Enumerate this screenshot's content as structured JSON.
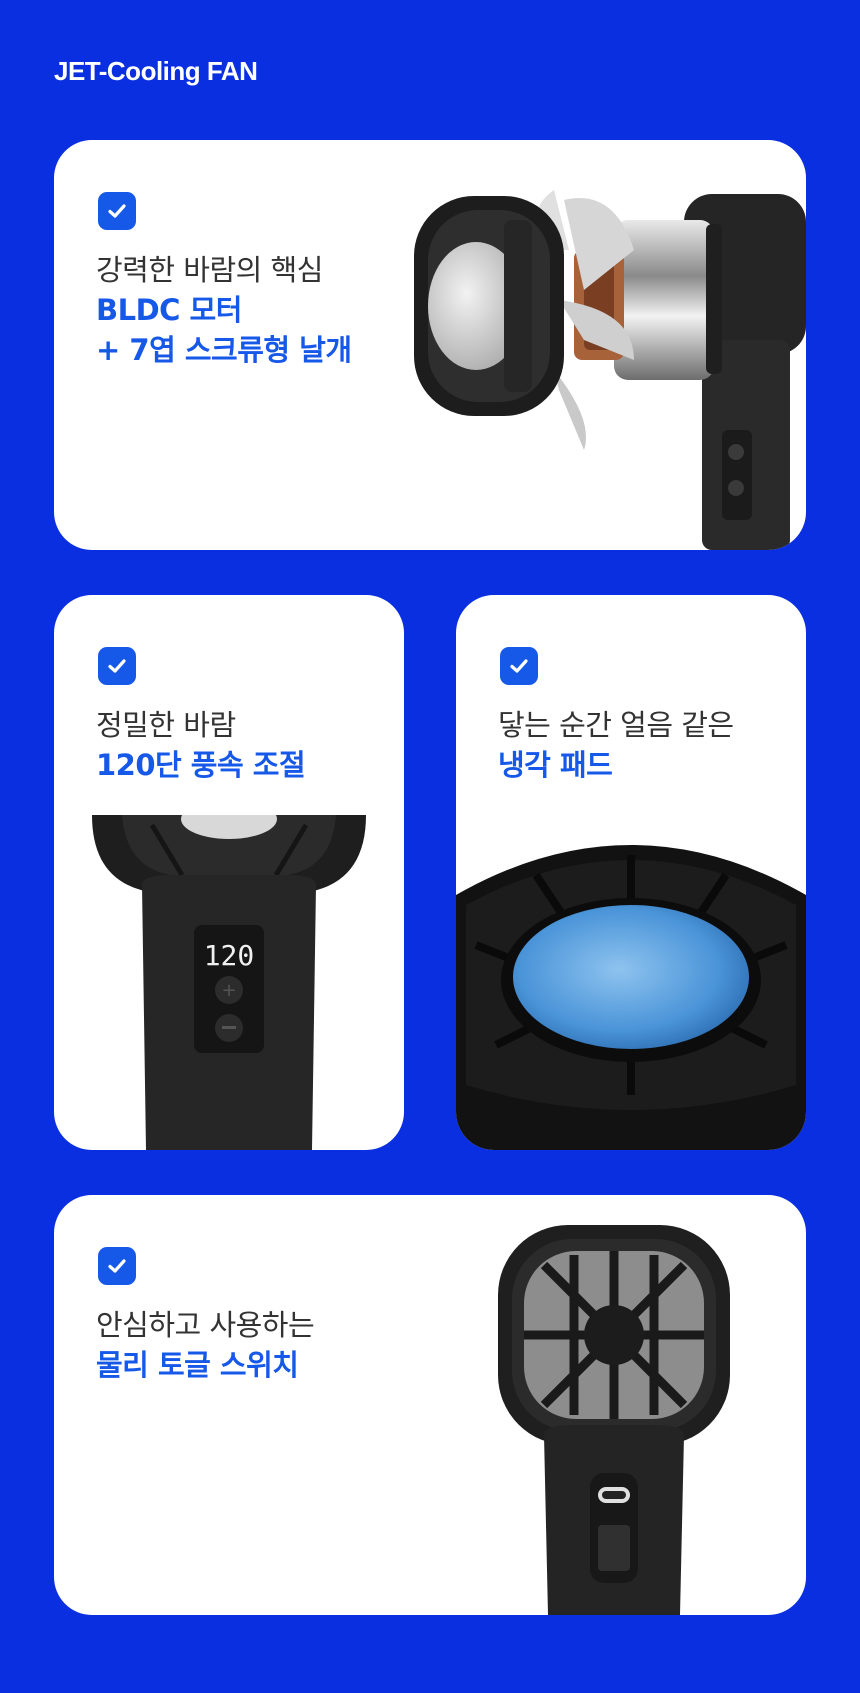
{
  "brand": {
    "title": "JET-Cooling FAN"
  },
  "colors": {
    "background": "#0a2fe0",
    "accent": "#1658e8",
    "card": "#ffffff"
  },
  "cards": [
    {
      "icon": "check-icon",
      "subtitle": "강력한 바람의 핵심",
      "highlight_1": "BLDC 모터",
      "highlight_2": "+ 7엽 스크류형 날개"
    },
    {
      "icon": "check-icon",
      "subtitle": "정밀한 바람",
      "highlight_1": "120단 풍속 조절",
      "display_value": "120"
    },
    {
      "icon": "check-icon",
      "subtitle": "닿는 순간 얼음 같은",
      "highlight_1": "냉각 패드"
    },
    {
      "icon": "check-icon",
      "subtitle": "안심하고 사용하는",
      "highlight_1": "물리 토글 스위치"
    }
  ]
}
